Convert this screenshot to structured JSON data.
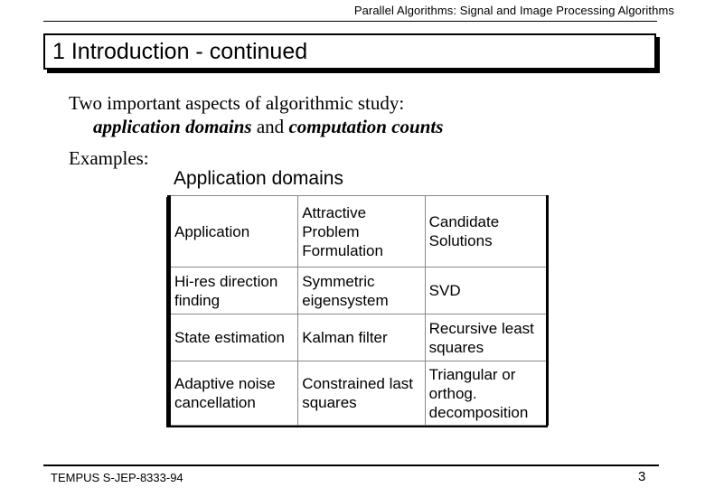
{
  "header": {
    "title": "Parallel Algorithms:  Signal and Image Processing Algorithms"
  },
  "slide": {
    "title": "1  Introduction - continued"
  },
  "intro": {
    "line1": "Two important aspects of algorithmic study:",
    "emph1": "application domains",
    "joiner": " and ",
    "emph2": "computation counts"
  },
  "examples_label": "Examples:",
  "table": {
    "title": "Application domains",
    "headers": [
      "Application",
      "Attractive Problem Formulation",
      "Candidate Solutions"
    ],
    "rows": [
      [
        "Hi-res direction finding",
        "Symmetric eigensystem",
        "SVD"
      ],
      [
        "State estimation",
        "Kalman filter",
        "Recursive least squares"
      ],
      [
        "Adaptive noise cancellation",
        "Constrained last squares",
        "Triangular or orthog. decomposition"
      ]
    ]
  },
  "footer": {
    "left": "TEMPUS S-JEP-8333-94",
    "page_number": "3"
  }
}
